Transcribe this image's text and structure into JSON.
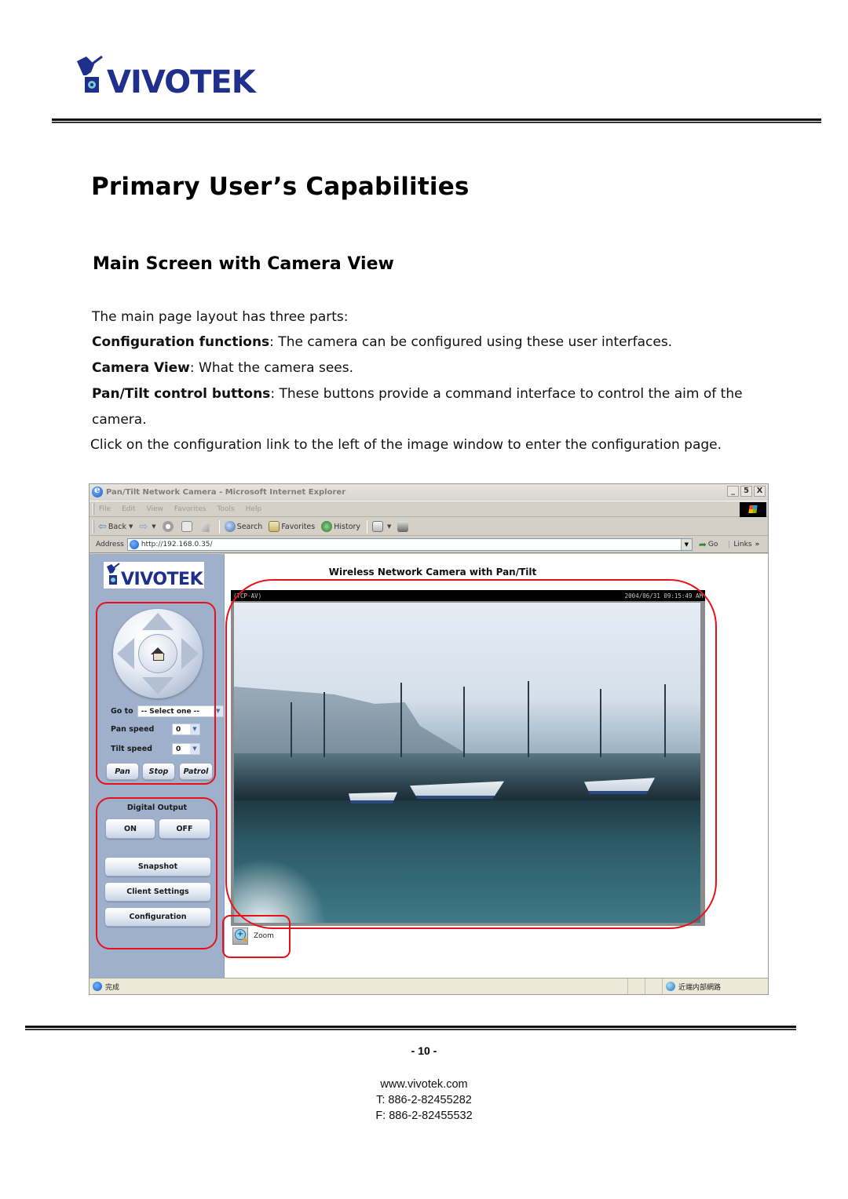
{
  "header": {
    "logo_text": "VIVOTEK",
    "brand_color": "#1e2f8c",
    "logo_accent_color": "#7ec9d4"
  },
  "document": {
    "title": "Primary User’s Capabilities",
    "section_title": "Main Screen with Camera View",
    "intro": "The main page layout has three parts:",
    "parts": [
      {
        "term": "Configuration functions",
        "desc": ": The camera can be configured using these user interfaces."
      },
      {
        "term": "Camera View",
        "desc": ": What the camera sees."
      },
      {
        "term": "Pan/Tilt control buttons",
        "desc": ": These buttons provide a command interface to control the aim of the camera."
      }
    ],
    "closing": "Click on the configuration link to the left of the image window to enter the configuration page."
  },
  "browser": {
    "window_title": "Pan/Tilt Network Camera - Microsoft Internet Explorer",
    "window_buttons": [
      "_",
      "5",
      "X"
    ],
    "menu": [
      "File",
      "Edit",
      "View",
      "Favorites",
      "Tools",
      "Help"
    ],
    "toolbar": {
      "back": "Back",
      "search": "Search",
      "favorites": "Favorites",
      "history": "History"
    },
    "address_label": "Address",
    "address_url": "http://192.168.0.35/",
    "go_label": "Go",
    "links_label": "Links",
    "links_chevron": "»",
    "status_text": "完成",
    "status_zone": "近端内部網路"
  },
  "camera_page": {
    "sidebar_logo": "VIVOTEK",
    "sidebar_color": "#9fb0cc",
    "goto_label": "Go to",
    "goto_selected": "-- Select one --",
    "pan_speed_label": "Pan speed",
    "pan_speed_value": "0",
    "tilt_speed_label": "Tilt speed",
    "tilt_speed_value": "0",
    "pan_button": "Pan",
    "stop_button": "Stop",
    "patrol_button": "Patrol",
    "digital_output_label": "Digital Output",
    "on_button": "ON",
    "off_button": "OFF",
    "snapshot_button": "Snapshot",
    "client_settings_button": "Client Settings",
    "configuration_button": "Configuration",
    "camera_title": "Wireless Network Camera with Pan/Tilt",
    "overlay_left": "(TCP-AV)",
    "overlay_right": "2004/06/31 09:15:49 AM",
    "zoom_label": "Zoom",
    "annotation_color": "#e8111a"
  },
  "footer": {
    "page_number": "- 10 -",
    "website": "www.vivotek.com",
    "phone": "T: 886-2-82455282",
    "fax": "F: 886-2-82455532"
  }
}
